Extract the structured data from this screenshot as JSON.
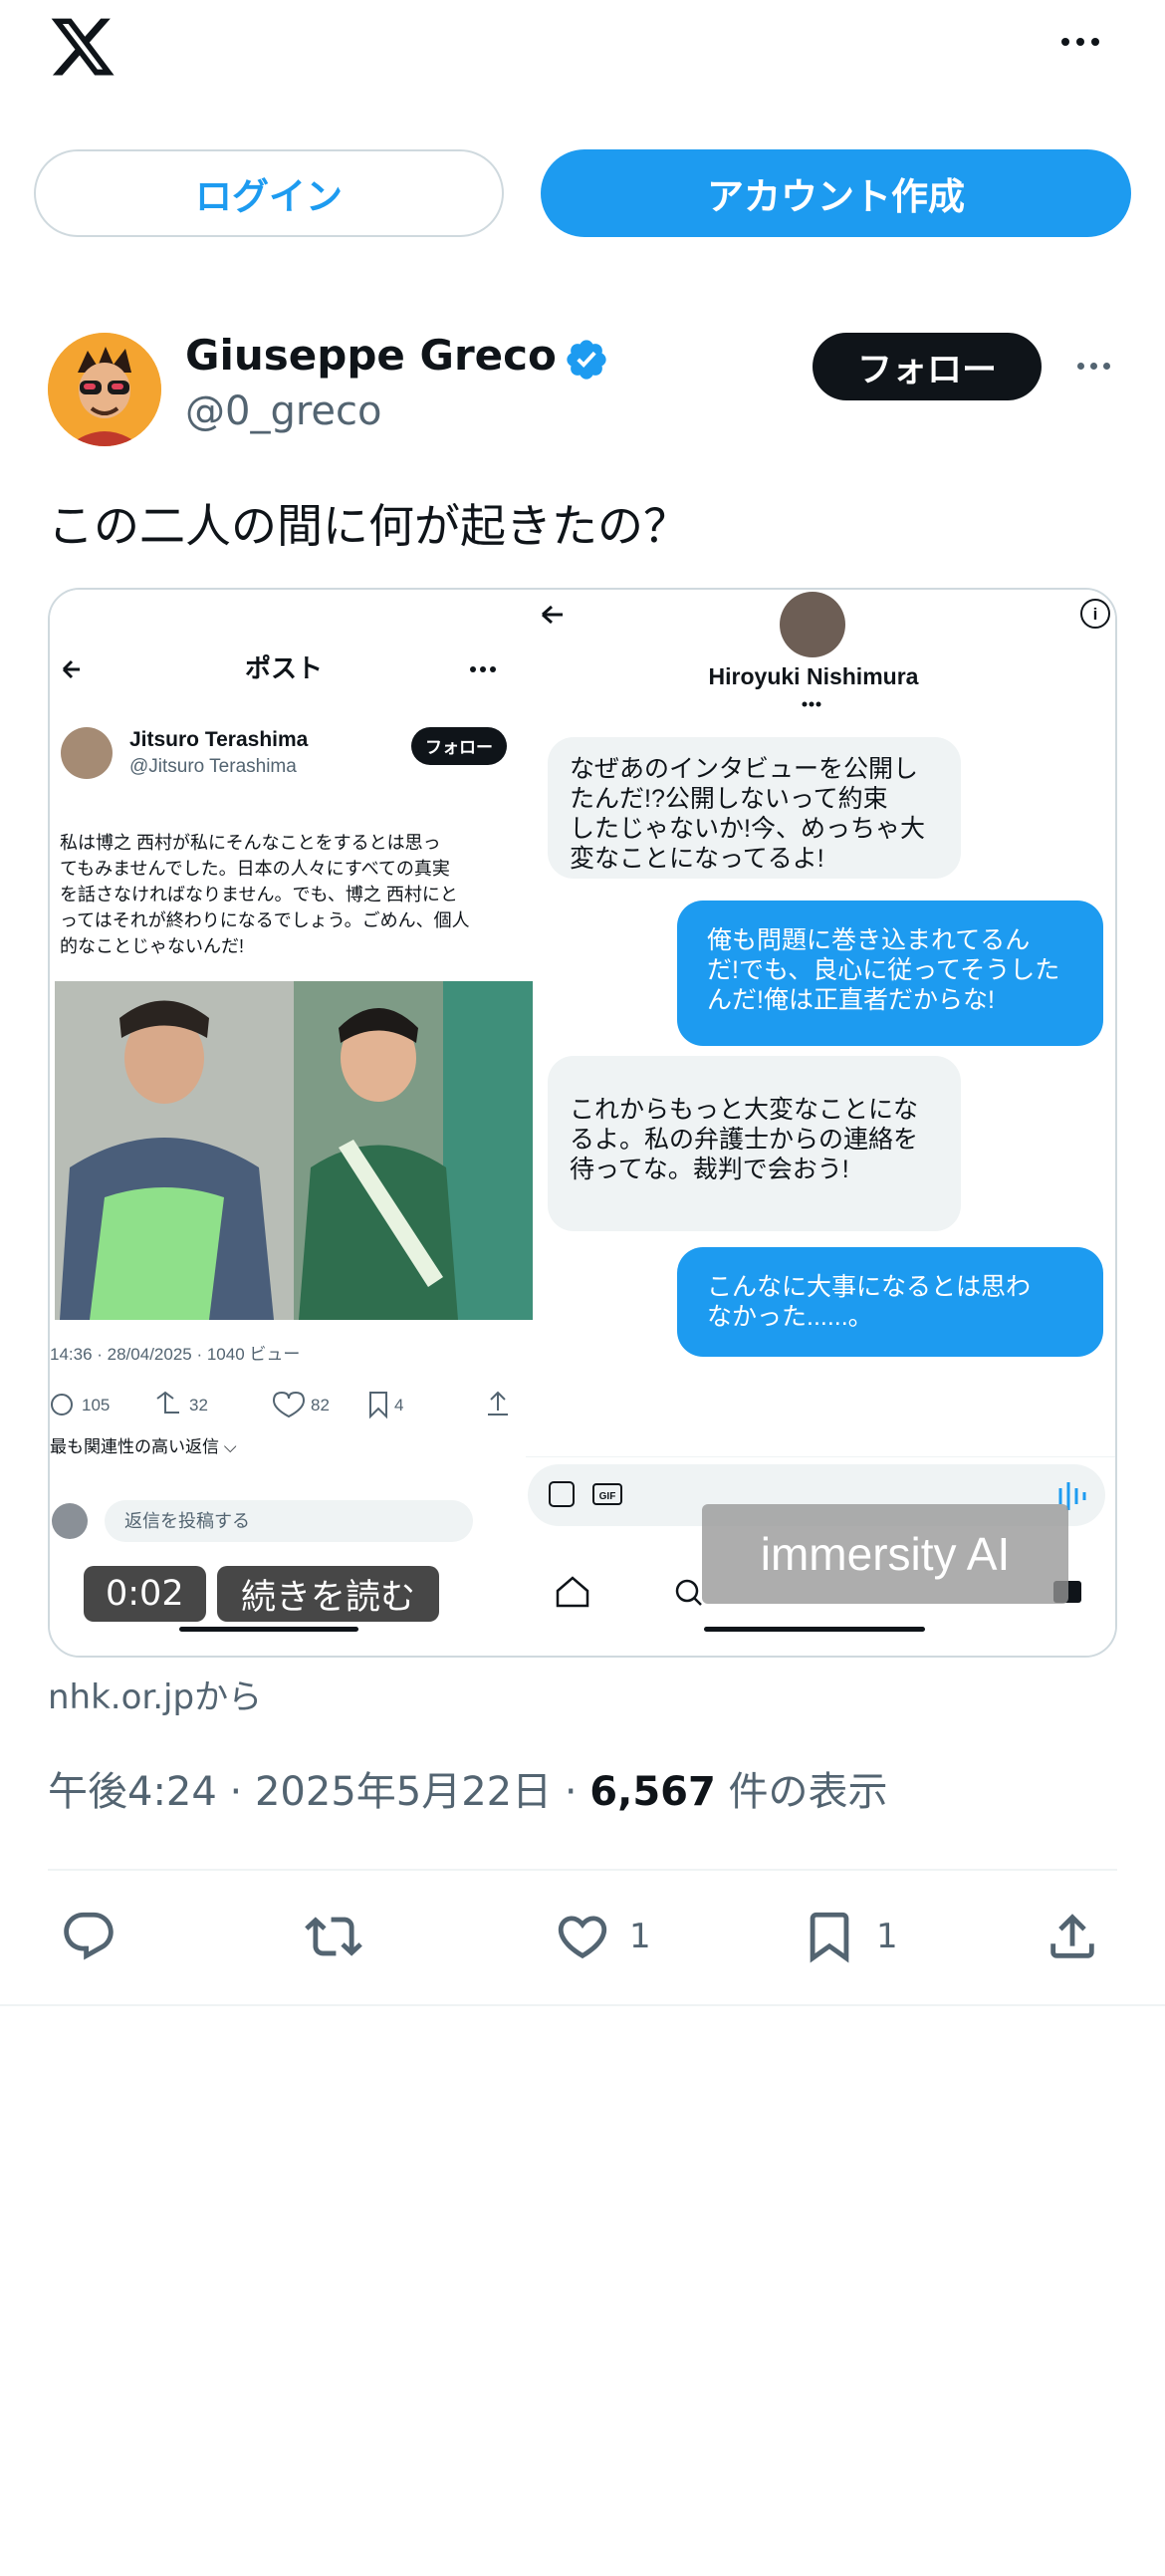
{
  "header": {
    "logo": "x-logo",
    "more_icon": "more-horizontal-icon"
  },
  "auth": {
    "login_label": "ログイン",
    "signup_label": "アカウント作成"
  },
  "post": {
    "author_name": "Giuseppe Greco",
    "author_handle": "@0_greco",
    "verified": true,
    "follow_label": "フォロー",
    "text": "この二人の間に何が起きたの？",
    "source": "nhk.or.jpから",
    "time": "午後4:24",
    "date": "2025年5月22日",
    "views_count": "6,567",
    "views_label": "件の表示",
    "replies": "",
    "reposts": "",
    "likes": "1",
    "bookmarks": "1"
  },
  "video": {
    "elapsed": "0:02",
    "read_more": "続きを読む",
    "watermark": "immersity AI",
    "left_screen": {
      "title": "ポスト",
      "author": "Jitsuro Terashima",
      "handle": "@Jitsuro Terashima",
      "follow": "フォロー",
      "body_lines": [
        "私は博之 西村が私にそんなことをするとは思っ",
        "てもみませんでした。日本の人々にすべての真実",
        "を話さなければなりません。でも、博之 西村にと",
        "ってはそれが終わりになるでしょう。ごめん、個人",
        "的なことじゃないんだ!"
      ],
      "stats": "14:36 · 28/04/2025 · 1040 ビュー",
      "replies": "105",
      "reposts": "32",
      "likes": "82",
      "bookmarks": "4",
      "relevant": "最も関連性の高い返信 ⌵",
      "reply_placeholder": "返信を投稿する"
    },
    "right_screen": {
      "contact": "Hiroyuki Nishimura",
      "messages": [
        {
          "side": "in",
          "lines": [
            "なぜあのインタビューを公開し",
            "たんだ!?公開しないって約束",
            "したじゃないか!今、めっちゃ大",
            "変なことになってるよ!"
          ]
        },
        {
          "side": "out",
          "lines": [
            "俺も問題に巻き込まれてるん",
            "だ!でも、良心に従ってそうした",
            "んだ!俺は正直者だからな!"
          ]
        },
        {
          "side": "in",
          "lines": [
            "これからもっと大変なことにな",
            "るよ。私の弁護士からの連絡を",
            "待ってな。裁判で会おう!"
          ]
        },
        {
          "side": "out",
          "lines": [
            "こんなに大事になるとは思わ",
            "なかった......。"
          ]
        }
      ]
    }
  },
  "colors": {
    "accent": "#1d9bf0",
    "text": "#0f1419",
    "muted": "#536471",
    "border": "#cfd9de"
  }
}
